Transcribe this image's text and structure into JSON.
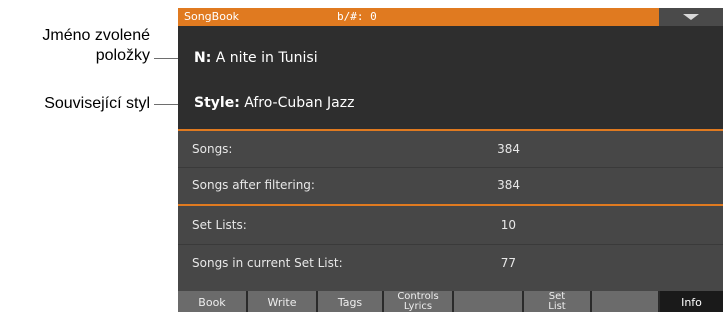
{
  "callouts": {
    "selected_name_line1": "Jméno zvolené",
    "selected_name_line2": "položky",
    "related_style": "Související styl"
  },
  "titlebar": {
    "title": "SongBook",
    "key_signature": "b/#: 0",
    "menu_icon": "chevron-down-icon"
  },
  "item": {
    "name_label": "N:",
    "name_value": "A nite in Tunisi",
    "style_label": "Style:",
    "style_value": "Afro-Cuban Jazz"
  },
  "stats": {
    "songs_label": "Songs:",
    "songs_value": "384",
    "filtered_label": "Songs after filtering:",
    "filtered_value": "384",
    "setlists_label": "Set Lists:",
    "setlists_value": "10",
    "current_label": "Songs in current Set List:",
    "current_value": "77"
  },
  "tabs": {
    "book": "Book",
    "write": "Write",
    "tags": "Tags",
    "controls_line1": "Controls",
    "controls_line2": "Lyrics",
    "empty1": "",
    "setlist_line1": "Set",
    "setlist_line2": "List",
    "empty2": "",
    "info": "Info"
  },
  "colors": {
    "accent": "#e07a20",
    "panel": "#2e2e2e",
    "stats_bg": "#474747",
    "tab_bg": "#6b6b6b",
    "tab_active": "#1a1a1a"
  }
}
